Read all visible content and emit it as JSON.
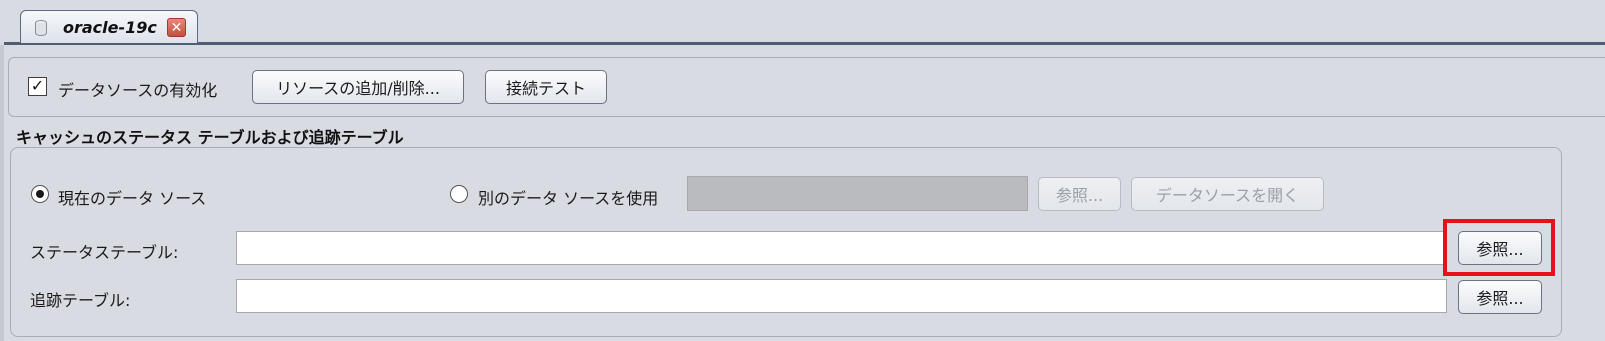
{
  "tab": {
    "title": "oracle-19c",
    "db_icon": "database-icon",
    "close_icon": "close-icon",
    "close_glyph": "✕"
  },
  "toolbar": {
    "enable_checkbox_checked": true,
    "enable_checkbox_glyph": "✓",
    "enable_label": "データソースの有効化",
    "add_remove_button": "リソースの追加/削除...",
    "test_connection_button": "接続テスト"
  },
  "section": {
    "title": "キャッシュのステータス テーブルおよび追跡テーブル"
  },
  "data_source": {
    "current_label": "現在のデータ ソース",
    "current_selected": true,
    "other_label": "別のデータ ソースを使用",
    "other_selected": false,
    "other_value": "",
    "browse_button": "参照...",
    "open_button": "データソースを開く"
  },
  "status_table": {
    "label": "ステータステーブル:",
    "value": "",
    "browse_button": "参照..."
  },
  "tracking_table": {
    "label": "追跡テーブル:",
    "value": "",
    "browse_button": "参照..."
  },
  "colors": {
    "background": "#d8dbe2",
    "highlight": "#e8101e",
    "tab_border": "#4f5e77"
  }
}
